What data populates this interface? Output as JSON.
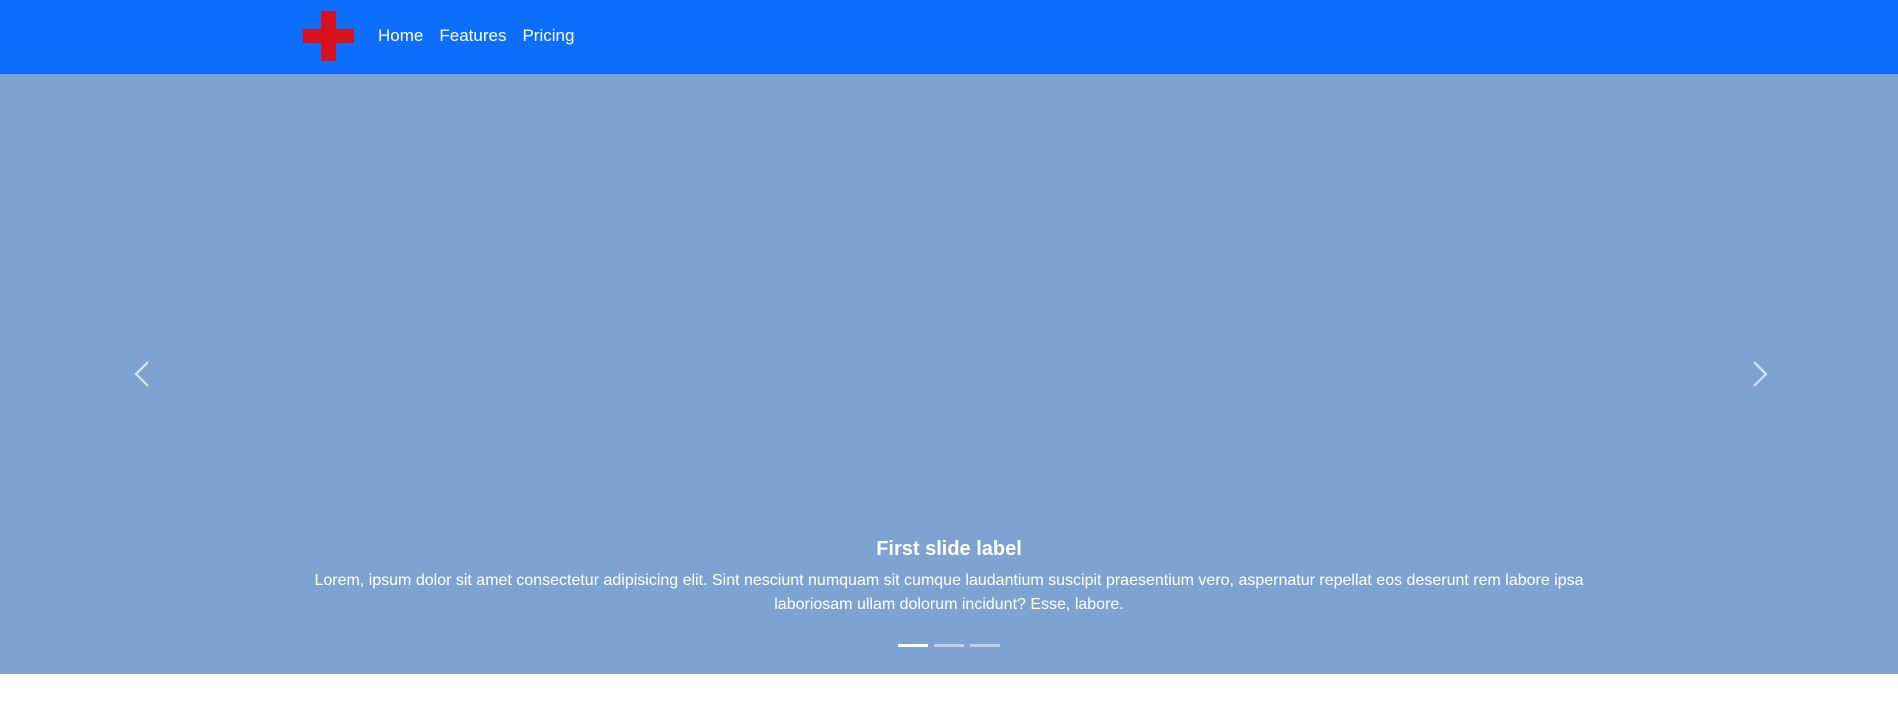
{
  "navbar": {
    "brand_icon": "red-cross-icon",
    "brand_color": "#d5121b",
    "background": "#0d6efd",
    "links": [
      {
        "label": "Home"
      },
      {
        "label": "Features"
      },
      {
        "label": "Pricing"
      }
    ]
  },
  "carousel": {
    "background": "#7fa3d1",
    "prev_icon": "chevron-left-icon",
    "next_icon": "chevron-right-icon",
    "caption": {
      "title": "First slide label",
      "text": "Lorem, ipsum dolor sit amet consectetur adipisicing elit. Sint nesciunt numquam sit cumque laudantium suscipit praesentium vero, aspernatur repellat eos deserunt rem labore ipsa laboriosam ullam dolorum incidunt? Esse, labore."
    },
    "indicators": {
      "count": 3,
      "active_index": 0
    }
  }
}
